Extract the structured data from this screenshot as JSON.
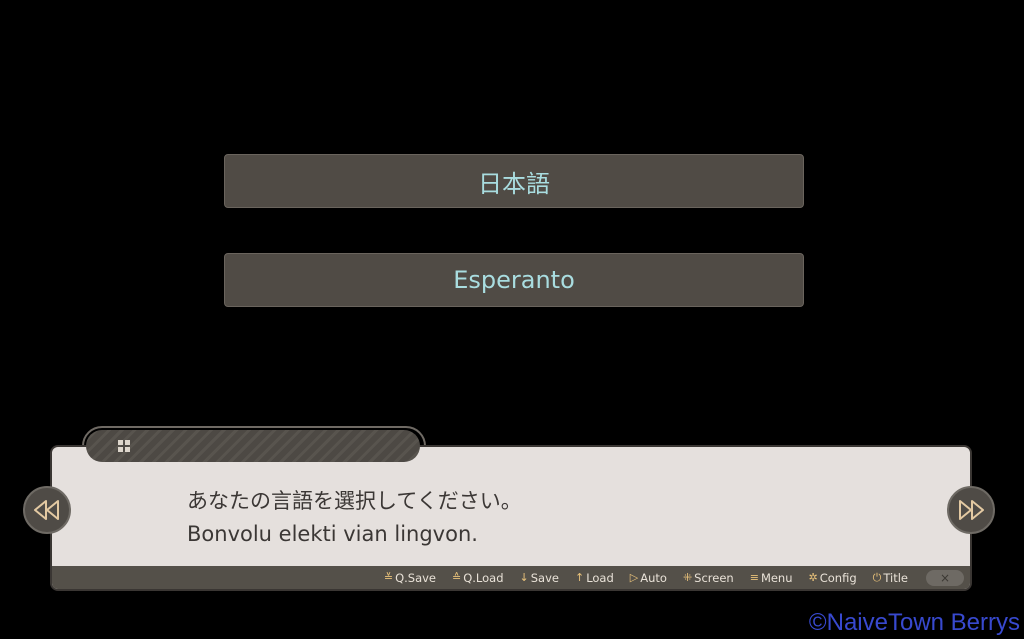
{
  "choices": [
    {
      "label": "日本語"
    },
    {
      "label": "Esperanto"
    }
  ],
  "message": {
    "lines": [
      "あなたの言語を選択してください。",
      "Bonvolu elekti vian lingvon."
    ]
  },
  "toolbar": {
    "items": [
      {
        "icon": "≚",
        "label": "Q.Save"
      },
      {
        "icon": "≙",
        "label": "Q.Load"
      },
      {
        "icon": "↓",
        "label": "Save"
      },
      {
        "icon": "↑",
        "label": "Load"
      },
      {
        "icon": "▷",
        "label": "Auto"
      },
      {
        "icon": "⁜",
        "label": "Screen"
      },
      {
        "icon": "≡",
        "label": "Menu"
      },
      {
        "icon": "✲",
        "label": "Config"
      },
      {
        "icon": "⏻",
        "label": "Title"
      }
    ],
    "close_glyph": "×"
  },
  "watermark": "©NaiveTown Berrys"
}
